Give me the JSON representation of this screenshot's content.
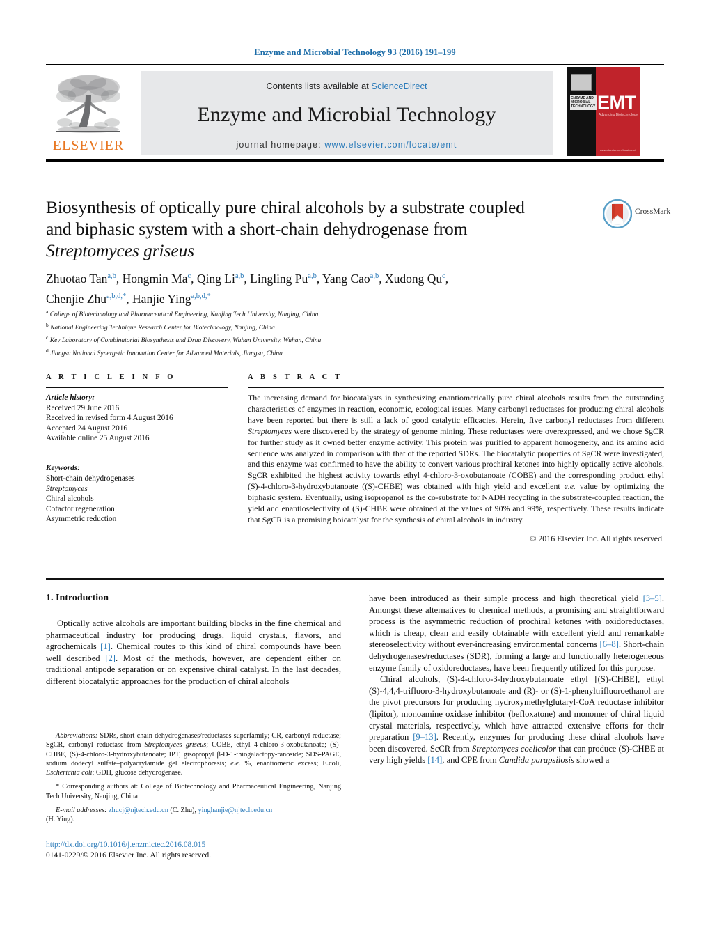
{
  "running_head": "Enzyme and Microbial Technology 93 (2016) 191–199",
  "masthead": {
    "publisher_logo_text": "ELSEVIER",
    "contents_prefix": "Contents lists available at ",
    "contents_link": "ScienceDirect",
    "journal_title": "Enzyme and Microbial Technology",
    "homepage_prefix": "journal homepage: ",
    "homepage_url": "www.elsevier.com/locate/emt",
    "cover": {
      "journal_name_lines": "ENZYME AND MICROBIAL TECHNOLOGY",
      "acronym": "EMT",
      "subtitle": "Advancing Biotechnology",
      "footer": "www.elsevier.com/locate/emt"
    }
  },
  "article": {
    "title_line1": "Biosynthesis of optically pure chiral alcohols by a substrate coupled",
    "title_line2": "and biphasic system with a short-chain dehydrogenase from",
    "title_italic_line3": "Streptomyces griseus",
    "crossmark_label": "CrossMark",
    "authors_line1": "Zhuotao Tan",
    "authors_html": "Zhuotao Tan a,b, Hongmin Ma c, Qing Li a,b, Lingling Pu a,b, Yang Cao a,b, Xudong Qu c, Chenjie Zhu a,b,d,*, Hanjie Ying a,b,d,*",
    "affiliations": [
      {
        "marker": "a",
        "text": "College of Biotechnology and Pharmaceutical Engineering, Nanjing Tech University, Nanjing, China"
      },
      {
        "marker": "b",
        "text": "National Engineering Technique Research Center for Biotechnology, Nanjing, China"
      },
      {
        "marker": "c",
        "text": "Key Laboratory of Combinatorial Biosynthesis and Drug Discovery, Wuhan University, Wuhan, China"
      },
      {
        "marker": "d",
        "text": "Jiangsu National Synergetic Innovation Center for Advanced Materials, Jiangsu, China"
      }
    ]
  },
  "article_info": {
    "heading": "A R T I C L E   I N F O",
    "history_label": "Article history:",
    "history": [
      "Received 29 June 2016",
      "Received in revised form 4 August 2016",
      "Accepted 24 August 2016",
      "Available online 25 August 2016"
    ],
    "keywords_label": "Keywords:",
    "keywords": [
      "Short-chain dehydrogenases",
      "Streptomyces",
      "Chiral alcohols",
      "Cofactor regeneration",
      "Asymmetric reduction"
    ],
    "keywords_italic_index": 1
  },
  "abstract": {
    "heading": "A B S T R A C T",
    "paragraph_part1": "The increasing demand for biocatalysts in synthesizing enantiomerically pure chiral alcohols results from the outstanding characteristics of enzymes in reaction, economic, ecological issues. Many carbonyl reductases for producing chiral alcohols have been reported but there is still a lack of good catalytic efficacies. Herein, five carbonyl reductases from different ",
    "italic1": "Streptomyces",
    "paragraph_part2": " were discovered by the strategy of genome mining. These reductases were overexpressed, and we chose SgCR for further study as it owned better enzyme activity. This protein was purified to apparent homogeneity, and its amino acid sequence was analyzed in comparison with that of the reported SDRs. The biocatalytic properties of SgCR were investigated, and this enzyme was confirmed to have the ability to convert various prochiral ketones into highly optically active alcohols. SgCR exhibited the highest activity towards ethyl 4-chloro-3-oxobutanoate (COBE) and the corresponding product ethyl (S)-4-chloro-3-hydroxybutanoate ((S)-CHBE) was obtained with high yield and excellent ",
    "italic2": "e.e.",
    "paragraph_part3": " value by optimizing the biphasic system. Eventually, using isopropanol as the co-substrate for NADH recycling in the substrate-coupled reaction, the yield and enantioselectivity of (S)-CHBE were obtained at the values of 90% and 99%, respectively. These results indicate that SgCR is a promising boicatalyst for the synthesis of chiral alcohols in industry.",
    "copyright": "© 2016 Elsevier Inc. All rights reserved."
  },
  "introduction": {
    "heading": "1.  Introduction",
    "left_p1_a": "Optically active alcohols are important building blocks in the fine chemical and pharmaceutical industry for producing drugs, liquid crystals, flavors, and agrochemicals ",
    "left_ref1": "[1]",
    "left_p1_b": ". Chemical routes to this kind of chiral compounds have been well described ",
    "left_ref2": "[2]",
    "left_p1_c": ". Most of the methods, however, are dependent either on traditional antipode separation or on expensive chiral catalyst. In the last decades, different biocatalytic approaches for the production of chiral alcohols",
    "right_p1_a": "have been introduced as their simple process and high theoretical yield ",
    "right_ref1": "[3–5]",
    "right_p1_b": ". Amongst these alternatives to chemical methods, a promising and straightforward process is the asymmetric reduction of prochiral ketones with oxidoreductases, which is cheap, clean and easily obtainable with excellent yield and remarkable stereoselectivity without ever-increasing environmental concerns ",
    "right_ref2": "[6–8]",
    "right_p1_c": ". Short-chain dehydrogenases/reductases (SDR), forming a large and functionally heterogeneous enzyme family of oxidoreductases, have been frequently utilized for this purpose.",
    "right_p2_a": "Chiral alcohols, (S)-4-chloro-3-hydroxybutanoate ethyl [(S)-CHBE], ethyl (S)-4,4,4-trifluoro-3-hydroxybutanoate and (R)- or (S)-1-phenyltrifluoroethanol are the pivot precursors for producing hydroxymethylglutaryl-CoA reductase inhibitor (lipitor), monoamine oxidase inhibitor (befloxatone) and monomer of chiral liquid crystal materials, respectively, which have attracted extensive efforts for their preparation ",
    "right_ref3": "[9–13]",
    "right_p2_b": ". Recently, enzymes for producing these chiral alcohols have been discovered. ScCR from ",
    "right_ital1": "Streptomyces coelicolor",
    "right_p2_c": " that can produce (S)-CHBE at very high yields ",
    "right_ref4": "[14]",
    "right_p2_d": ", and CPE from ",
    "right_ital2": "Candida parapsilosis",
    "right_p2_e": " showed a"
  },
  "footnotes": {
    "abbrev_label": "Abbreviations:",
    "abbrev_a": " SDRs, short-chain dehydrogenases/reductases superfamily; CR, carbonyl reductase; SgCR, carbonyl reductase from ",
    "abbrev_ital1": "Streptomyces griseus",
    "abbrev_b": "; COBE, ethyl 4-chloro-3-oxobutanoate; (S)-CHBE, (S)-4-chloro-3-hydroxybutanoate; IPT, gisopropyl β-D-1-thiogalactopy-ranoside; SDS-PAGE, sodium dodecyl sulfate–polyacrylamide gel electrophoresis; ",
    "abbrev_ital2": "e.e.",
    "abbrev_c": " %, enantiomeric excess; E.coli, ",
    "abbrev_ital3": "Escherichia coli",
    "abbrev_d": "; GDH, glucose dehydrogenase.",
    "corresponding": "*  Corresponding authors at: College of Biotechnology and Pharmaceutical Engineering, Nanjing Tech University, Nanjing, China",
    "email_label": "E-mail addresses:",
    "email1": "zhucj@njtech.edu.cn",
    "email1_owner": " (C. Zhu), ",
    "email2": "yinghanjie@njtech.edu.cn",
    "email2_owner": "(H. Ying)."
  },
  "footer": {
    "doi": "http://dx.doi.org/10.1016/j.enzmictec.2016.08.015",
    "issn": "0141-0229/© 2016 Elsevier Inc. All rights reserved."
  },
  "colors": {
    "link_blue": "#2a7ab9",
    "elsevier_orange": "#e87722",
    "banner_gray": "#e7e8ea",
    "cover_red": "#c0232b"
  }
}
